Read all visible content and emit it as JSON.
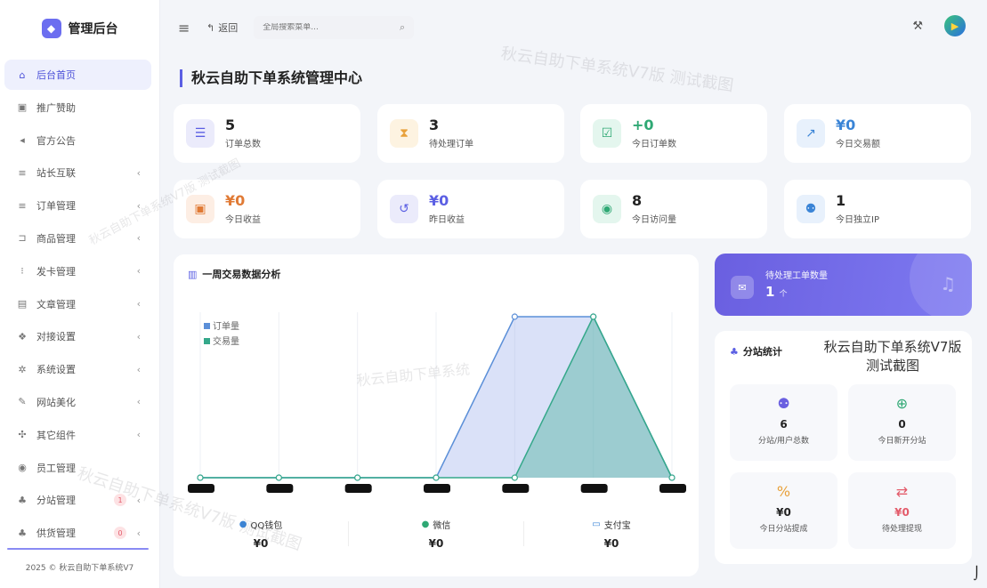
{
  "sidebar": {
    "brand": "管理后台",
    "items": [
      {
        "label": "后台首页",
        "icon": "home-icon",
        "glyph": "⌂",
        "active": true
      },
      {
        "label": "推广赞助",
        "icon": "image-icon",
        "glyph": "▣"
      },
      {
        "label": "官方公告",
        "icon": "megaphone-icon",
        "glyph": "◂"
      },
      {
        "label": "站长互联",
        "icon": "list-icon",
        "glyph": "≡",
        "arrow": "‹"
      },
      {
        "label": "订单管理",
        "icon": "list-icon",
        "glyph": "≡",
        "arrow": "‹"
      },
      {
        "label": "商品管理",
        "icon": "cart-icon",
        "glyph": "⊐",
        "arrow": "‹"
      },
      {
        "label": "发卡管理",
        "icon": "grid-icon",
        "glyph": "⁝",
        "arrow": "‹"
      },
      {
        "label": "文章管理",
        "icon": "book-icon",
        "glyph": "▤",
        "arrow": "‹"
      },
      {
        "label": "对接设置",
        "icon": "cubes-icon",
        "glyph": "❖",
        "arrow": "‹"
      },
      {
        "label": "系统设置",
        "icon": "gear-icon",
        "glyph": "✲",
        "arrow": "‹"
      },
      {
        "label": "网站美化",
        "icon": "brush-icon",
        "glyph": "✎",
        "arrow": "‹"
      },
      {
        "label": "其它组件",
        "icon": "gears-icon",
        "glyph": "✣",
        "arrow": "‹"
      },
      {
        "label": "员工管理",
        "icon": "user-icon",
        "glyph": "◉"
      },
      {
        "label": "分站管理",
        "icon": "sitemap-icon",
        "glyph": "♣",
        "arrow": "‹",
        "badge": "1"
      },
      {
        "label": "供货管理",
        "icon": "sitemap-icon",
        "glyph": "♣",
        "arrow": "‹",
        "badge": "0"
      }
    ],
    "footer": "2025 © 秋云自助下单系统V7"
  },
  "topbar": {
    "back_label": "返回",
    "search_placeholder": "全局搜索菜单..."
  },
  "page_title": "秋云自助下单系统管理中心",
  "stats": [
    {
      "value": "5",
      "label": "订单总数",
      "icon": "list-ol-icon",
      "glyph": "☰",
      "bg": "#ebebfb",
      "fg": "#5b5fe3"
    },
    {
      "value": "3",
      "label": "待处理订单",
      "icon": "hourglass-icon",
      "glyph": "⧗",
      "bg": "#fdf3e1",
      "fg": "#e8a13a"
    },
    {
      "value": "+0",
      "label": "今日订单数",
      "icon": "calendar-check-icon",
      "glyph": "☑",
      "bg": "#e4f6ee",
      "fg": "#2fa874",
      "color": "#2fa874"
    },
    {
      "value": "¥0",
      "label": "今日交易额",
      "icon": "chart-line-icon",
      "glyph": "↗",
      "bg": "#e8f1fc",
      "fg": "#3a84d6",
      "color": "#3a84d6"
    },
    {
      "value": "¥0",
      "label": "今日收益",
      "icon": "money-icon",
      "glyph": "▣",
      "bg": "#fdeee4",
      "fg": "#e07a35",
      "color": "#e07a35"
    },
    {
      "value": "¥0",
      "label": "昨日收益",
      "icon": "history-icon",
      "glyph": "↺",
      "bg": "#ebebfb",
      "fg": "#5b5fe3",
      "color": "#5b5fe3"
    },
    {
      "value": "8",
      "label": "今日访问量",
      "icon": "eye-icon",
      "glyph": "◉",
      "bg": "#e4f6ee",
      "fg": "#2fa874"
    },
    {
      "value": "1",
      "label": "今日独立IP",
      "icon": "users-icon",
      "glyph": "⚉",
      "bg": "#e8f1fc",
      "fg": "#3a84d6"
    }
  ],
  "chart": {
    "title": "一周交易数据分析",
    "payments": [
      {
        "name": "QQ钱包",
        "icon": "qq-icon",
        "glyph": "●",
        "color": "#3a84d6",
        "value": "¥0"
      },
      {
        "name": "微信",
        "icon": "wechat-icon",
        "glyph": "●",
        "color": "#2fa874",
        "value": "¥0"
      },
      {
        "name": "支付宝",
        "icon": "credit-card-icon",
        "glyph": "▭",
        "color": "#3a84d6",
        "value": "¥0"
      }
    ]
  },
  "chart_data": {
    "type": "area",
    "categories": [
      "",
      "",
      "",
      "",
      "",
      "",
      ""
    ],
    "series": [
      {
        "name": "订单量",
        "values": [
          0,
          0,
          0,
          0,
          1,
          1,
          0
        ],
        "color": "#5b8fd8"
      },
      {
        "name": "交易量",
        "values": [
          0,
          0,
          0,
          0,
          0,
          1,
          0
        ],
        "color": "#35a88a"
      }
    ],
    "ylim": [
      0,
      1
    ],
    "grid": true,
    "legend": "top-left"
  },
  "ticket": {
    "label": "待处理工单数量",
    "value": "1",
    "unit": "个"
  },
  "branch": {
    "title": "分站统计",
    "note_line1": "秋云自助下单系统V7版",
    "note_line2": "测试截图",
    "tiles": [
      {
        "value": "6",
        "label": "分站/用户总数",
        "icon": "users-icon",
        "glyph": "⚉",
        "color": "#6a5fe0"
      },
      {
        "value": "0",
        "label": "今日新开分站",
        "icon": "plus-circle-icon",
        "glyph": "⊕",
        "color": "#2fa874"
      },
      {
        "value": "¥0",
        "label": "今日分站提成",
        "icon": "percent-icon",
        "glyph": "%",
        "color": "#e8a13a"
      },
      {
        "value": "¥0",
        "label": "待处理提现",
        "icon": "exchange-icon",
        "glyph": "⇄",
        "color": "#e35b6a",
        "value_color": "#e35b6a"
      }
    ]
  },
  "watermark": {
    "text_top": "秋云自助下单系统V7版 测试截图",
    "text_diag": "秋云自助下单系统V7版 测试截图",
    "text_small": "秋云自助下单系统V7版 测试截图",
    "text_mid": "秋云自助下单系统"
  }
}
